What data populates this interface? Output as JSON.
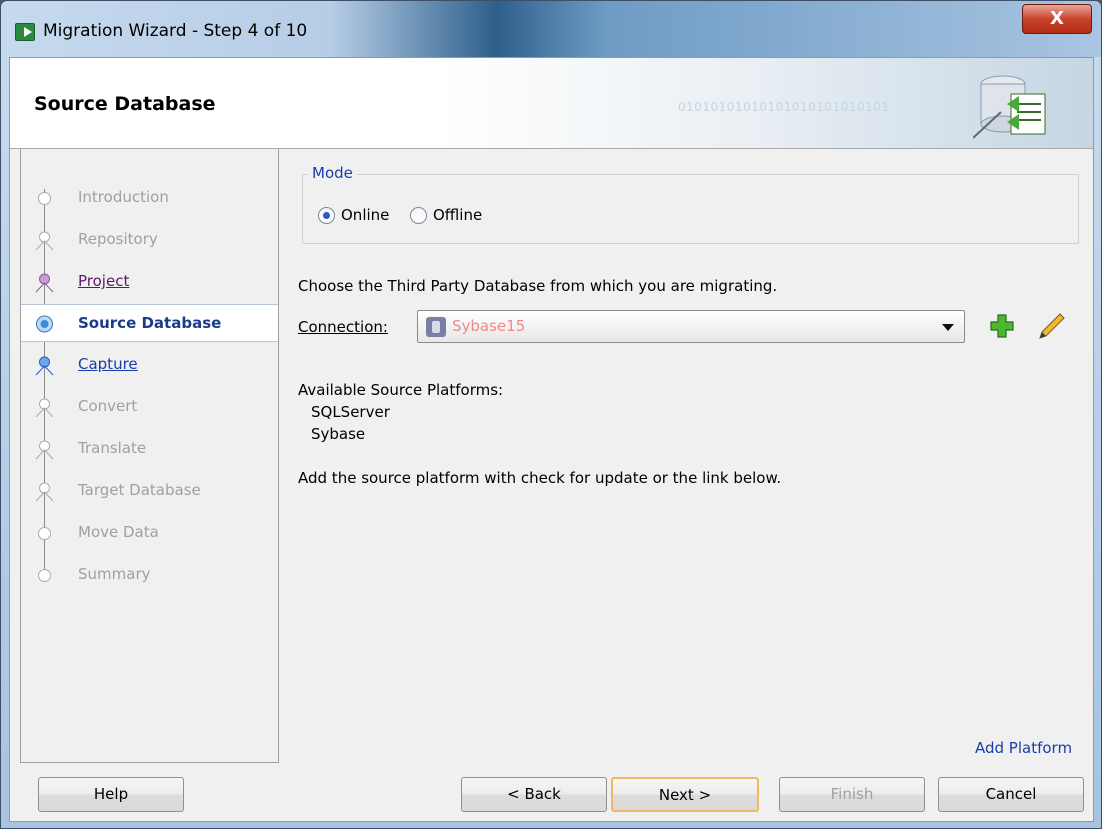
{
  "window": {
    "title": "Migration Wizard - Step 4 of 10",
    "close_label": "X"
  },
  "banner": {
    "heading": "Source Database",
    "binary_text": "01010101010101010101010101"
  },
  "nav": {
    "steps": [
      {
        "label": "Introduction",
        "state": "disabled"
      },
      {
        "label": "Repository",
        "state": "disabled"
      },
      {
        "label": "Project",
        "state": "visited"
      },
      {
        "label": "Source Database",
        "state": "current"
      },
      {
        "label": "Capture ",
        "state": "next"
      },
      {
        "label": "Convert",
        "state": "disabled"
      },
      {
        "label": "Translate",
        "state": "disabled"
      },
      {
        "label": "Target Database",
        "state": "disabled"
      },
      {
        "label": "Move Data",
        "state": "disabled"
      },
      {
        "label": "Summary",
        "state": "disabled"
      }
    ]
  },
  "mode": {
    "legend": "Mode",
    "online_label": "Online",
    "offline_label": "Offline",
    "selected": "Online"
  },
  "main": {
    "choose_text": "Choose the Third Party Database from which you are migrating.",
    "connection_label": "Connection:",
    "connection_value": "Sybase15",
    "platforms_heading": "Available Source Platforms:",
    "platforms": [
      "SQLServer",
      "Sybase"
    ],
    "hint": "Add the source platform with check for update or the link below.",
    "add_platform_link": "Add Platform"
  },
  "buttons": {
    "help": "Help",
    "back": "< Back",
    "next": "Next >",
    "finish": "Finish",
    "cancel": "Cancel"
  },
  "colors": {
    "link": "#1a3ca8",
    "connection_text": "#f08a8a",
    "default_button_border": "#f0b860"
  },
  "icons": [
    "app-icon",
    "database-wizard-icon",
    "add-connection-icon",
    "edit-connection-icon",
    "radio-icon"
  ]
}
